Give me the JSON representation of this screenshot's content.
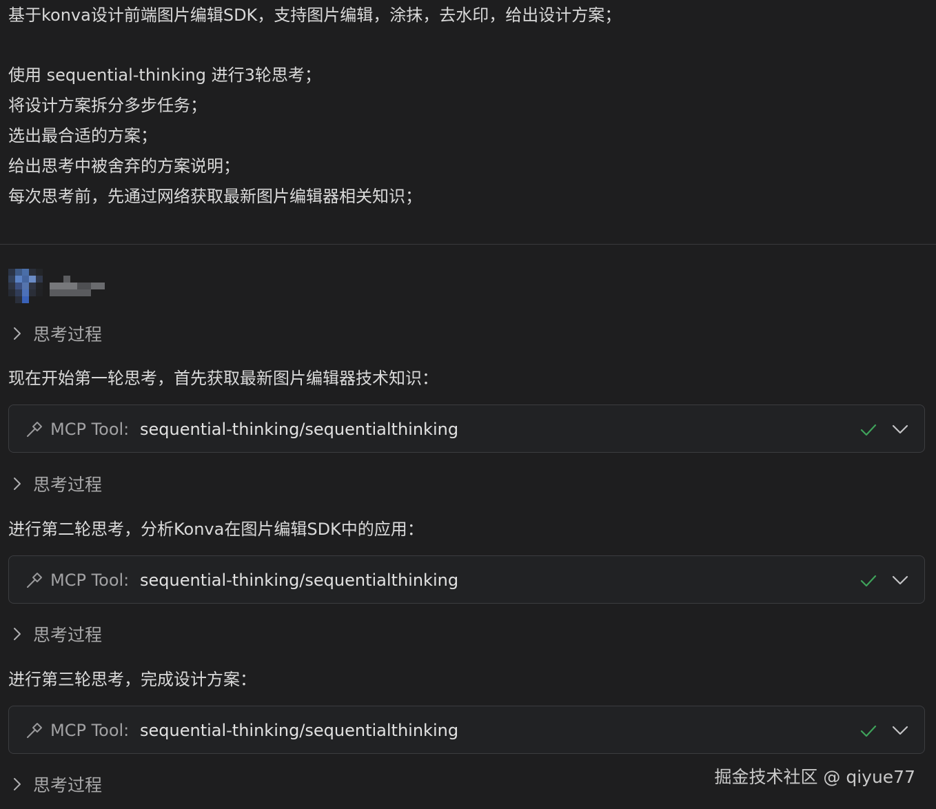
{
  "prompt": {
    "lines": [
      "基于konva设计前端图片编辑SDK，支持图片编辑，涂抹，去水印，给出设计方案；",
      "使用 sequential-thinking 进行3轮思考；",
      "将设计方案拆分多步任务；",
      "选出最合适的方案；",
      "给出思考中被舍弃的方案说明；",
      "每次思考前，先通过网络获取最新图片编辑器相关知识；"
    ]
  },
  "thinking_label": "思考过程",
  "messages": [
    "现在开始第一轮思考，首先获取最新图片编辑器技术知识：",
    "进行第二轮思考，分析Konva在图片编辑SDK中的应用：",
    "进行第三轮思考，完成设计方案："
  ],
  "tool_calls": [
    {
      "label": "MCP Tool:",
      "name": "sequential-thinking/sequentialthinking",
      "status": "success"
    },
    {
      "label": "MCP Tool:",
      "name": "sequential-thinking/sequentialthinking",
      "status": "success"
    },
    {
      "label": "MCP Tool:",
      "name": "sequential-thinking/sequentialthinking",
      "status": "success"
    }
  ],
  "watermark": "掘金技术社区 @ qiyue77",
  "colors": {
    "background": "#1e1e1f",
    "tool_border": "#3c3d40",
    "success": "#3fa35b",
    "muted_text": "#a9a9aa"
  },
  "icons": {
    "thinking_toggle": "chevron-right-icon",
    "tool": "hammer-icon",
    "status": "check-icon",
    "expand": "chevron-down-icon"
  }
}
